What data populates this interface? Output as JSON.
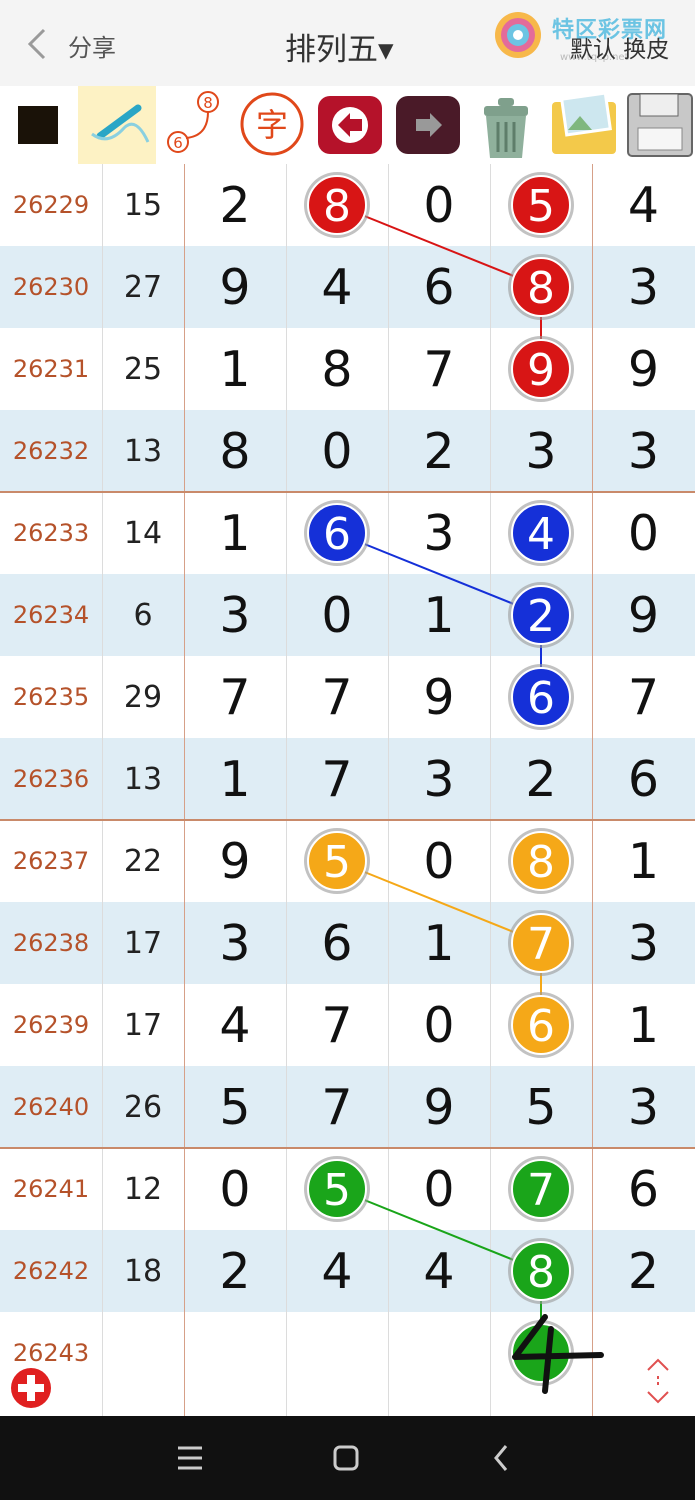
{
  "header": {
    "back_label": "",
    "share_label": "分享",
    "title": "排列五▾",
    "logo_text": "特区彩票网",
    "logo_url": "www.tqcp.net",
    "skin_label": "默认 换皮"
  },
  "toolbar": {
    "items": [
      "color-square",
      "pen-tool",
      "number-link-tool",
      "char-tool",
      "undo",
      "redo",
      "trash",
      "image",
      "save"
    ],
    "char_label": "字",
    "link_top": "8",
    "link_bottom": "6"
  },
  "columns": [
    "issue",
    "sum",
    "d1",
    "d2",
    "d3",
    "d4",
    "d5"
  ],
  "rows": [
    {
      "issue": "26229",
      "sum": "15",
      "digits": [
        "2",
        "8",
        "0",
        "5",
        "4"
      ]
    },
    {
      "issue": "26230",
      "sum": "27",
      "digits": [
        "9",
        "4",
        "6",
        "8",
        "3"
      ]
    },
    {
      "issue": "26231",
      "sum": "25",
      "digits": [
        "1",
        "8",
        "7",
        "9",
        "9"
      ]
    },
    {
      "issue": "26232",
      "sum": "13",
      "digits": [
        "8",
        "0",
        "2",
        "3",
        "3"
      ]
    },
    {
      "issue": "26233",
      "sum": "14",
      "digits": [
        "1",
        "6",
        "3",
        "4",
        "0"
      ]
    },
    {
      "issue": "26234",
      "sum": "6",
      "digits": [
        "3",
        "0",
        "1",
        "2",
        "9"
      ]
    },
    {
      "issue": "26235",
      "sum": "29",
      "digits": [
        "7",
        "7",
        "9",
        "6",
        "7"
      ]
    },
    {
      "issue": "26236",
      "sum": "13",
      "digits": [
        "1",
        "7",
        "3",
        "2",
        "6"
      ]
    },
    {
      "issue": "26237",
      "sum": "22",
      "digits": [
        "9",
        "5",
        "0",
        "8",
        "1"
      ]
    },
    {
      "issue": "26238",
      "sum": "17",
      "digits": [
        "3",
        "6",
        "1",
        "7",
        "3"
      ]
    },
    {
      "issue": "26239",
      "sum": "17",
      "digits": [
        "4",
        "7",
        "0",
        "6",
        "1"
      ]
    },
    {
      "issue": "26240",
      "sum": "26",
      "digits": [
        "5",
        "7",
        "9",
        "5",
        "3"
      ]
    },
    {
      "issue": "26241",
      "sum": "12",
      "digits": [
        "0",
        "5",
        "0",
        "7",
        "6"
      ]
    },
    {
      "issue": "26242",
      "sum": "18",
      "digits": [
        "2",
        "4",
        "4",
        "8",
        "2"
      ]
    },
    {
      "issue": "26243",
      "sum": "",
      "digits": [
        "",
        "",
        "",
        "",
        ""
      ]
    }
  ],
  "marks": [
    {
      "color": "#d81515",
      "balls": [
        {
          "row": 0,
          "col": 1
        },
        {
          "row": 0,
          "col": 3
        },
        {
          "row": 1,
          "col": 3
        },
        {
          "row": 2,
          "col": 3
        }
      ],
      "lines": [
        [
          [
            0,
            1
          ],
          [
            1,
            3
          ]
        ],
        [
          [
            1,
            3
          ],
          [
            2,
            3
          ]
        ]
      ]
    },
    {
      "color": "#1530d8",
      "balls": [
        {
          "row": 4,
          "col": 1
        },
        {
          "row": 4,
          "col": 3
        },
        {
          "row": 5,
          "col": 3
        },
        {
          "row": 6,
          "col": 3
        }
      ],
      "lines": [
        [
          [
            4,
            1
          ],
          [
            5,
            3
          ]
        ],
        [
          [
            5,
            3
          ],
          [
            6,
            3
          ]
        ]
      ]
    },
    {
      "color": "#f5a818",
      "balls": [
        {
          "row": 8,
          "col": 1
        },
        {
          "row": 8,
          "col": 3
        },
        {
          "row": 9,
          "col": 3
        },
        {
          "row": 10,
          "col": 3
        }
      ],
      "lines": [
        [
          [
            8,
            1
          ],
          [
            9,
            3
          ]
        ],
        [
          [
            9,
            3
          ],
          [
            10,
            3
          ]
        ]
      ]
    },
    {
      "color": "#1aa51a",
      "balls": [
        {
          "row": 12,
          "col": 1
        },
        {
          "row": 12,
          "col": 3
        },
        {
          "row": 13,
          "col": 3
        },
        {
          "row": 14,
          "col": 3
        }
      ],
      "lines": [
        [
          [
            12,
            1
          ],
          [
            13,
            3
          ]
        ],
        [
          [
            13,
            3
          ],
          [
            14,
            3
          ]
        ]
      ]
    }
  ],
  "handwriting": {
    "text": "4",
    "row": 14,
    "col": 3
  },
  "navbar": {
    "items": [
      "menu",
      "home",
      "back"
    ]
  },
  "colors": {
    "issue_text": "#b5522a",
    "row_alt": "#dfedf5",
    "divider": "#c98a6a",
    "add_button": "#e02020",
    "scroll_button": "#e05050"
  }
}
